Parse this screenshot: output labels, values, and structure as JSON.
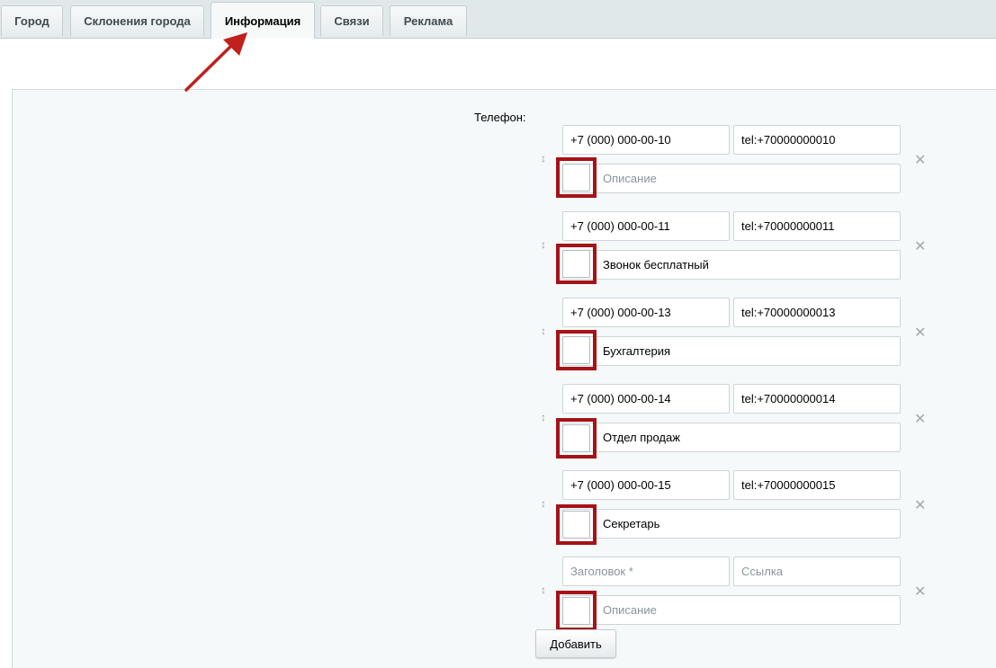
{
  "tabs": [
    {
      "label": "Город",
      "active": false
    },
    {
      "label": "Склонения города",
      "active": false
    },
    {
      "label": "Информация",
      "active": true
    },
    {
      "label": "Связи",
      "active": false
    },
    {
      "label": "Реклама",
      "active": false
    }
  ],
  "phone_field": {
    "label": "Телефон:",
    "entries": [
      {
        "number": "+7 (000) 000-00-10",
        "link": "tel:+70000000010",
        "description": "",
        "description_placeholder": "Описание"
      },
      {
        "number": "+7 (000) 000-00-11",
        "link": "tel:+70000000011",
        "description": "Звонок бесплатный",
        "description_placeholder": "Описание"
      },
      {
        "number": "+7 (000) 000-00-13",
        "link": "tel:+70000000013",
        "description": "Бухгалтерия",
        "description_placeholder": "Описание"
      },
      {
        "number": "+7 (000) 000-00-14",
        "link": "tel:+70000000014",
        "description": "Отдел продаж",
        "description_placeholder": "Описание"
      },
      {
        "number": "+7 (000) 000-00-15",
        "link": "tel:+70000000015",
        "description": "Секретарь",
        "description_placeholder": "Описание"
      }
    ],
    "new_entry": {
      "title_placeholder": "Заголовок *",
      "link_placeholder": "Ссылка",
      "description_placeholder": "Описание"
    },
    "add_button": "Добавить"
  },
  "icons": {
    "drag": "drag-handle-icon",
    "delete": "close-icon",
    "annotation_arrow": "arrow-icon"
  },
  "colors": {
    "highlight": "#a51317",
    "arrow": "#c0201e",
    "panel_bg": "#f5f9f9",
    "tabbar_bg": "#e0e8ea"
  }
}
